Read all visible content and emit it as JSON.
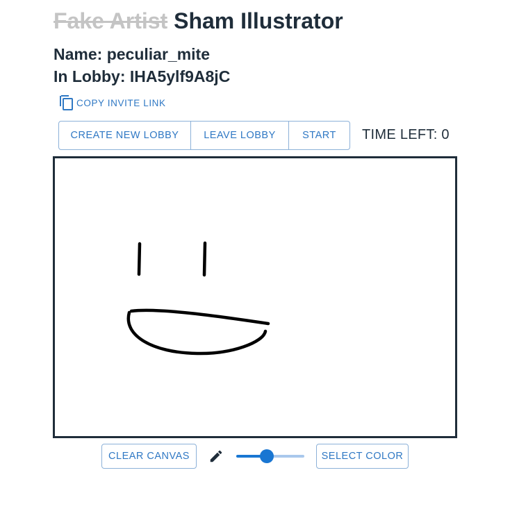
{
  "header": {
    "title_struck": "Fake Artist",
    "title": "Sham Illustrator"
  },
  "player": {
    "name_label": "Name: peculiar_mite",
    "lobby_label": "In Lobby: IHA5ylf9A8jC"
  },
  "invite": {
    "label": "COPY INVITE LINK",
    "icon": "copy-icon"
  },
  "lobby_actions": {
    "create_label": "CREATE NEW LOBBY",
    "leave_label": "LEAVE LOBBY",
    "start_label": "START"
  },
  "timer": {
    "label": "TIME LEFT: 0"
  },
  "tools": {
    "clear_label": "CLEAR CANVAS",
    "pencil_icon": "pencil-icon",
    "brush_size_percent": 45,
    "select_color_label": "SELECT COLOR"
  },
  "colors": {
    "accent": "#2f78c4",
    "border": "#8cb1d8",
    "slider": "#1976d2",
    "text": "#1f2d3a",
    "stroke": "#000000"
  }
}
